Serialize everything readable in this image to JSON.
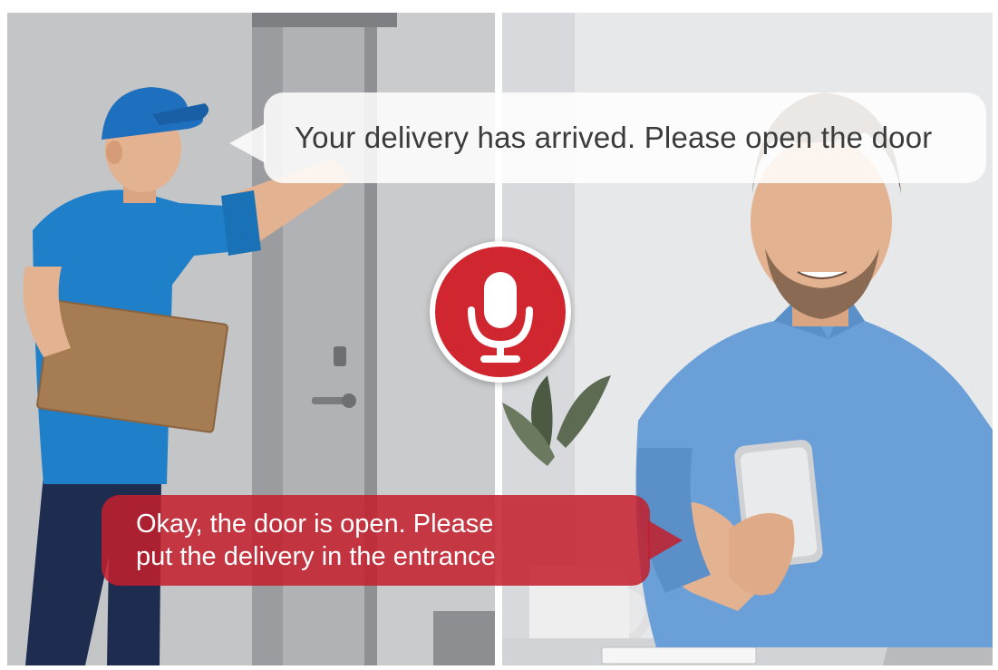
{
  "image": {
    "left_scene": "delivery-courier",
    "right_scene": "resident-with-phone"
  },
  "bubbles": {
    "courier_message": "Your delivery has arrived. Please open the door",
    "resident_message_line1": "Okay, the door is open. Please",
    "resident_message_line2": "put the delivery in the entrance"
  },
  "icons": {
    "center": "microphone-icon"
  },
  "colors": {
    "accent_red": "#d02630",
    "bubble_red": "#c4202c",
    "bubble_white": "#ffffff",
    "uniform_blue": "#1f7fc8",
    "shirt_blue": "#6a9fd8"
  }
}
